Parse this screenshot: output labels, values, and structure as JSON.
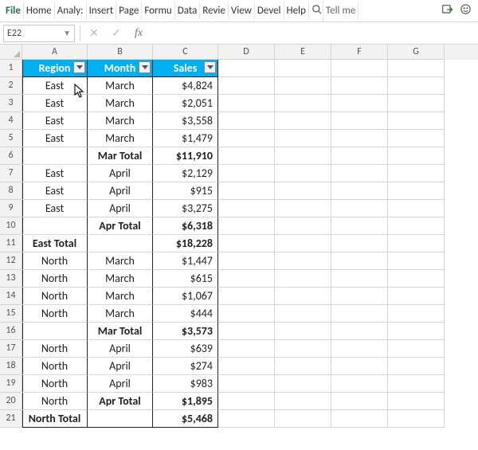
{
  "ribbon": {
    "tabs": [
      "File",
      "Home",
      "Analy:",
      "Insert",
      "Page",
      "Formu",
      "Data",
      "Revie",
      "View",
      "Devel",
      "Help"
    ],
    "search_icon": "🔍",
    "tell_me": "Tell me"
  },
  "formula_bar": {
    "name_box": "E22",
    "fx": "fx",
    "value": ""
  },
  "columns": [
    "A",
    "B",
    "C",
    "D",
    "E",
    "F",
    "G"
  ],
  "header_row": {
    "a": "Region",
    "b": "Month",
    "c": "Sales"
  },
  "rows": [
    {
      "n": "2",
      "a": "East",
      "b": "March",
      "c": "$4,824"
    },
    {
      "n": "3",
      "a": "East",
      "b": "March",
      "c": "$2,051"
    },
    {
      "n": "4",
      "a": "East",
      "b": "March",
      "c": "$3,558"
    },
    {
      "n": "5",
      "a": "East",
      "b": "March",
      "c": "$1,479"
    },
    {
      "n": "6",
      "a": "",
      "b": "Mar Total",
      "c": "$11,910",
      "bold": true
    },
    {
      "n": "7",
      "a": "East",
      "b": "April",
      "c": "$2,129"
    },
    {
      "n": "8",
      "a": "East",
      "b": "April",
      "c": "$915"
    },
    {
      "n": "9",
      "a": "East",
      "b": "April",
      "c": "$3,275"
    },
    {
      "n": "10",
      "a": "",
      "b": "Apr Total",
      "c": "$6,318",
      "bold": true
    },
    {
      "n": "11",
      "a": "East Total",
      "b": "",
      "c": "$18,228",
      "bold": true
    },
    {
      "n": "12",
      "a": "North",
      "b": "March",
      "c": "$1,447"
    },
    {
      "n": "13",
      "a": "North",
      "b": "March",
      "c": "$615"
    },
    {
      "n": "14",
      "a": "North",
      "b": "March",
      "c": "$1,067"
    },
    {
      "n": "15",
      "a": "North",
      "b": "March",
      "c": "$444"
    },
    {
      "n": "16",
      "a": "",
      "b": "Mar Total",
      "c": "$3,573",
      "bold": true
    },
    {
      "n": "17",
      "a": "North",
      "b": "April",
      "c": "$639"
    },
    {
      "n": "18",
      "a": "North",
      "b": "April",
      "c": "$274"
    },
    {
      "n": "19",
      "a": "North",
      "b": "April",
      "c": "$983"
    },
    {
      "n": "20",
      "a": "North",
      "b": "Apr Total",
      "c": "$1,895",
      "bold_bc": true
    },
    {
      "n": "21",
      "a": "North Total",
      "b": "",
      "c": "$5,468",
      "bold": true
    }
  ]
}
